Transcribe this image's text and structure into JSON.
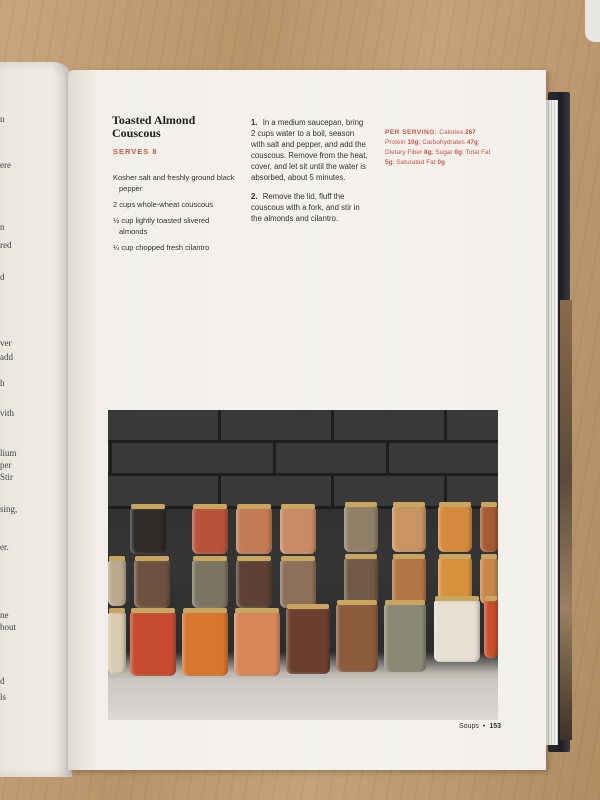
{
  "recipe": {
    "title": "Toasted Almond Couscous",
    "serves": "SERVES 8",
    "ingredients": [
      "Kosher salt and freshly ground black pepper",
      "2 cups whole-wheat couscous",
      "½ cup lightly toasted slivered almonds",
      "¼ cup chopped fresh cilantro"
    ],
    "steps": [
      {
        "num": "1.",
        "text": "In a medium saucepan, bring 2 cups water to a boil, season with salt and pepper, and add the couscous. Remove from the heat, cover, and let sit until the water is absorbed, about 5 minutes."
      },
      {
        "num": "2.",
        "text": "Remove the lid, fluff the couscous with a fork, and stir in the almonds and cilantro."
      }
    ],
    "nutrition": {
      "heading": "PER SERVING:",
      "calories_label": "Calories",
      "calories": "267",
      "protein_label": "Protein",
      "protein": "10g",
      "carbs_label": "Carbohydrates",
      "carbs": "47g",
      "fiber_label": "Dietary Fiber",
      "fiber": "8g",
      "sugar_label": "Sugar",
      "sugar": "0g",
      "fat_label": "Total Fat",
      "fat": "5g",
      "satfat_label": "Saturated Fat",
      "satfat": "0g"
    }
  },
  "footer": {
    "section": "Soups",
    "separator": "•",
    "page": "153"
  },
  "left_page_fragments": [
    "n",
    "ere",
    "n",
    "red",
    "d",
    "ver",
    "add",
    "h",
    "vith",
    "lium",
    "per",
    "Stir",
    "sing,",
    "er.",
    "ne",
    "bout",
    "d",
    "ls"
  ],
  "colors": {
    "accent": "#c4574a",
    "page": "#f5f2ed",
    "tile": "#363535"
  }
}
